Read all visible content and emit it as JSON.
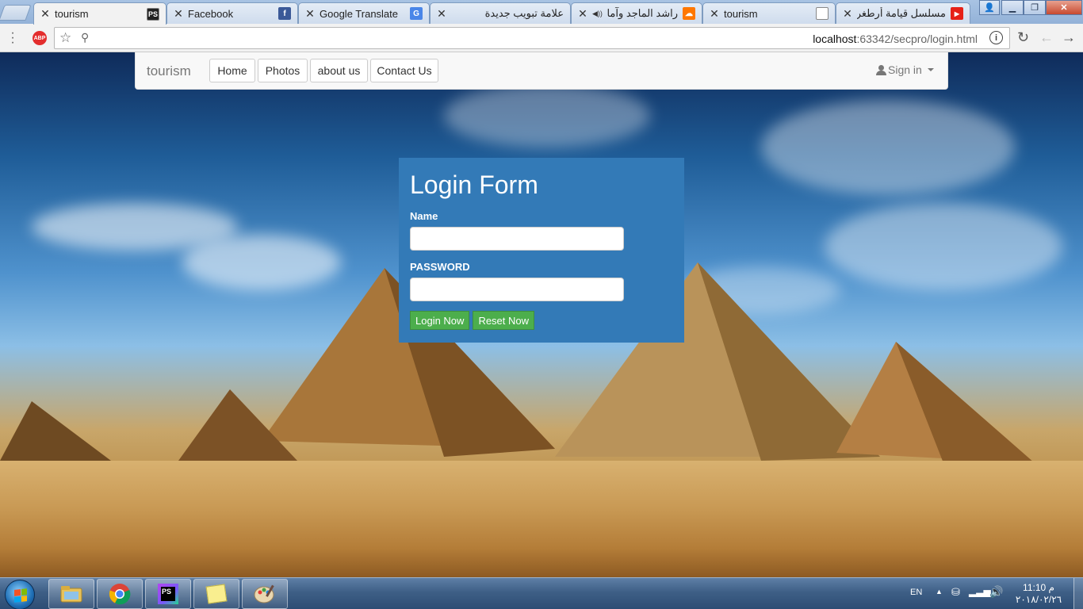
{
  "browser": {
    "tabs": [
      {
        "title": "tourism",
        "icon": "phpstorm-icon",
        "active": true
      },
      {
        "title": "Facebook",
        "icon": "facebook-icon"
      },
      {
        "title": "Google Translate",
        "icon": "google-translate-icon"
      },
      {
        "title": "علامة تبويب جديدة",
        "icon": "blank-page-icon"
      },
      {
        "title": "راشد الماجد وآمال ماهـ",
        "icon": "soundcloud-icon"
      },
      {
        "title": "tourism",
        "icon": "document-icon"
      },
      {
        "title": "مسلسل قيامة أرطغرل الموسـ",
        "icon": "youtube-icon"
      }
    ],
    "address": {
      "host": "localhost",
      "rest": ":63342/secpro/login.html"
    },
    "adblock_label": "ABP"
  },
  "site": {
    "brand": "tourism",
    "nav": [
      {
        "label": "Home"
      },
      {
        "label": "Photos"
      },
      {
        "label": "about us"
      },
      {
        "label": "Contact Us"
      }
    ],
    "signin_label": "Sign in"
  },
  "login_form": {
    "title": "Login Form",
    "name_label": "Name",
    "name_value": "",
    "password_label": "PASSWORD",
    "password_value": "",
    "login_button": "Login Now",
    "reset_button": "Reset Now",
    "panel_color": "#337ab7",
    "button_color": "#4cae4c"
  },
  "taskbar": {
    "apps": [
      "explorer-icon",
      "chrome-icon",
      "phpstorm-icon",
      "sticky-notes-icon",
      "paint-icon"
    ],
    "language": "EN",
    "time": "11:10 م",
    "date": "٢٠١٨/٠٢/٢٦"
  }
}
